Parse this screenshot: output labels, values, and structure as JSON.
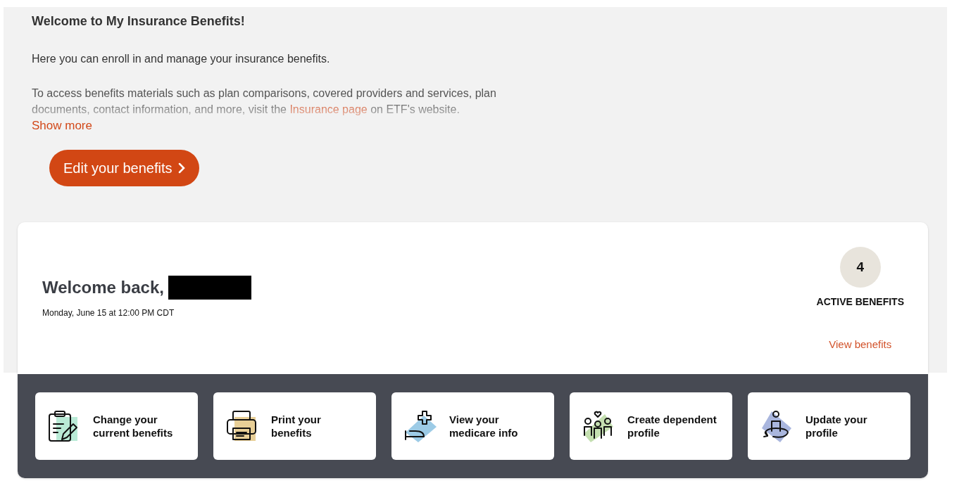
{
  "intro": {
    "title": "Welcome to My Insurance Benefits!",
    "lead": "Here you can enroll in and manage your insurance benefits.",
    "details": {
      "before": "To access benefits materials such as plan comparisons, covered providers and services, plan documents, contact information, and more, visit the ",
      "link": "Insurance page",
      "after": " on ETF's website.",
      "expanded": false
    },
    "toggle": "Show more",
    "action": "Edit your benefits"
  },
  "summary": {
    "greeting": "Welcome back,",
    "timestamp": "Monday, June 15 at 12:00 PM CDT",
    "count": "4",
    "count_label": "ACTIVE BENEFITS",
    "link": "View benefits"
  },
  "shortcuts": [
    {
      "kind": "clipboard",
      "label": "Change your current benefits",
      "color": "#b9ead6"
    },
    {
      "kind": "printer",
      "label": "Print your benefits",
      "color": "#e8cf97"
    },
    {
      "kind": "medical",
      "label": "View your medicare info",
      "color": "#9ccbe6"
    },
    {
      "kind": "family",
      "label": "Create dependent profile",
      "color": "#c4dfb0"
    },
    {
      "kind": "profile",
      "label": "Update your profile",
      "color": "#a9b6de"
    }
  ]
}
